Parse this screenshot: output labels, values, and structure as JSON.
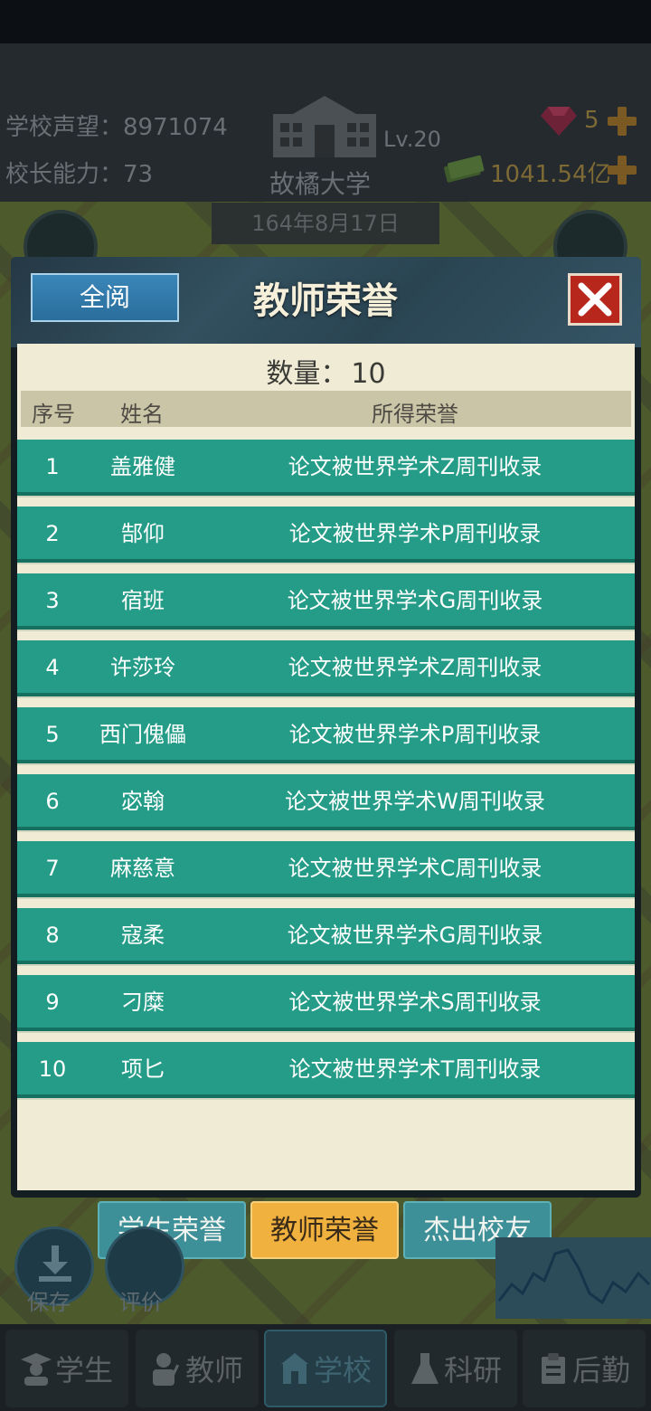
{
  "hud": {
    "reputation_label": "学校声望：",
    "reputation_value": "8971074",
    "ability_label": "校长能力：",
    "ability_value": "73",
    "level": "Lv.20",
    "school_name": "故橘大学",
    "gems": "5",
    "money": "1041.54亿",
    "date": "164年8月17日"
  },
  "modal": {
    "read_all_label": "全阅",
    "title": "教师荣誉",
    "count_label": "数量：",
    "count_value": "10",
    "columns": {
      "index": "序号",
      "name": "姓名",
      "honor": "所得荣誉"
    },
    "rows": [
      {
        "index": "1",
        "name": "盖雅健",
        "honor": "论文被世界学术Z周刊收录"
      },
      {
        "index": "2",
        "name": "郜仰",
        "honor": "论文被世界学术P周刊收录"
      },
      {
        "index": "3",
        "name": "宿班",
        "honor": "论文被世界学术G周刊收录"
      },
      {
        "index": "4",
        "name": "许莎玲",
        "honor": "论文被世界学术Z周刊收录"
      },
      {
        "index": "5",
        "name": "西门傀儡",
        "honor": "论文被世界学术P周刊收录"
      },
      {
        "index": "6",
        "name": "宓翰",
        "honor": "论文被世界学术W周刊收录"
      },
      {
        "index": "7",
        "name": "麻慈意",
        "honor": "论文被世界学术C周刊收录"
      },
      {
        "index": "8",
        "name": "寇柔",
        "honor": "论文被世界学术G周刊收录"
      },
      {
        "index": "9",
        "name": "刁糜",
        "honor": "论文被世界学术S周刊收录"
      },
      {
        "index": "10",
        "name": "项匕",
        "honor": "论文被世界学术T周刊收录"
      }
    ]
  },
  "tabs": [
    {
      "label": "学生荣誉",
      "active": false
    },
    {
      "label": "教师荣誉",
      "active": true
    },
    {
      "label": "杰出校友",
      "active": false
    }
  ],
  "side_buttons": {
    "save": "保存",
    "rate": "评价"
  },
  "bottom_nav": [
    {
      "label": "学生",
      "icon": "student-icon",
      "active": false
    },
    {
      "label": "教师",
      "icon": "teacher-icon",
      "active": false
    },
    {
      "label": "学校",
      "icon": "school-icon",
      "active": true
    },
    {
      "label": "科研",
      "icon": "flask-icon",
      "active": false
    },
    {
      "label": "后勤",
      "icon": "clipboard-icon",
      "active": false
    }
  ],
  "colors": {
    "row_bg": "#259c88",
    "panel_bg": "#efebd4",
    "tab_active": "#f0b13e",
    "tab_inactive": "#3d8f98",
    "close_button": "#b7271c"
  }
}
